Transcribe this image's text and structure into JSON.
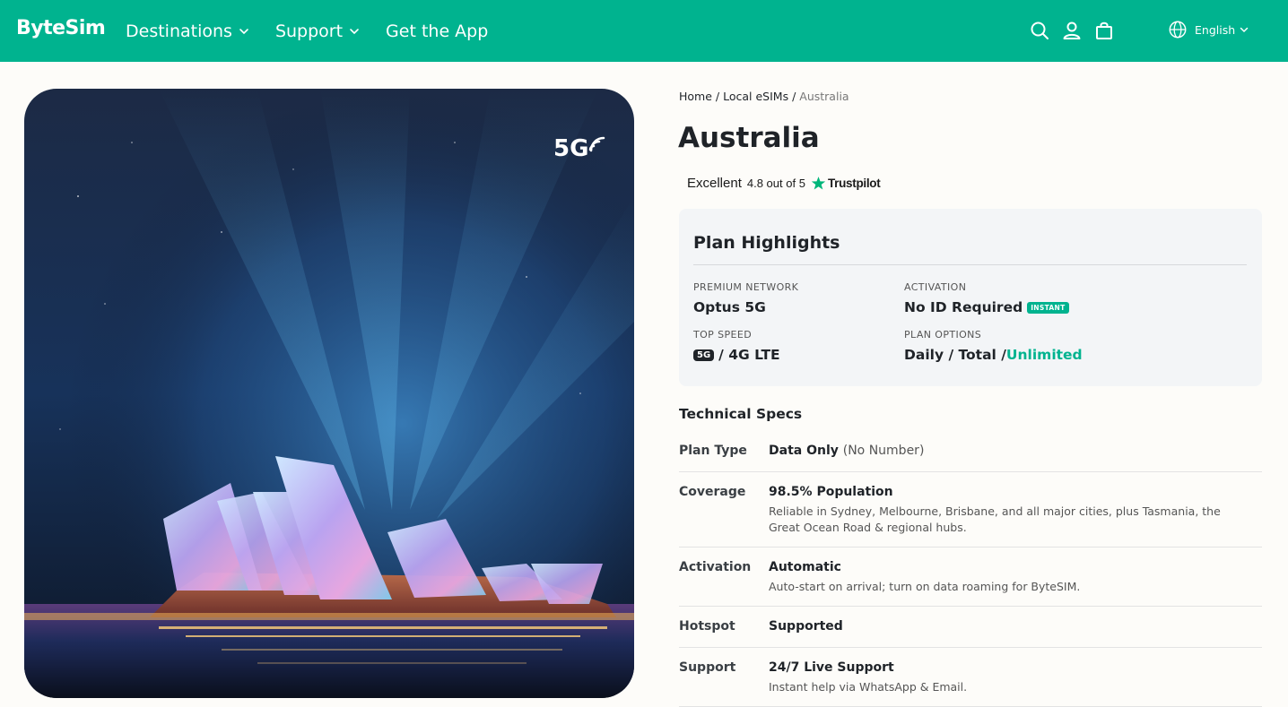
{
  "header": {
    "logo": "ByteSim",
    "nav": [
      {
        "label": "Destinations",
        "has_dropdown": true
      },
      {
        "label": "Support",
        "has_dropdown": true
      },
      {
        "label": "Get the App",
        "has_dropdown": false
      }
    ],
    "icons": [
      "search-icon",
      "user-icon",
      "bag-icon"
    ],
    "language": "English",
    "brand_color": "#00b38f"
  },
  "hero": {
    "badge": "5G"
  },
  "breadcrumb": {
    "home": "Home",
    "sep": "/",
    "section": "Local eSIMs",
    "current": "Australia"
  },
  "page_title": "Australia",
  "rating": {
    "label": "Excellent",
    "score": "4.8 out of 5",
    "provider": "Trustpilot"
  },
  "highlights": {
    "title": "Plan Highlights",
    "network": {
      "label": "PREMIUM NETWORK",
      "value": "Optus 5G"
    },
    "activation": {
      "label": "ACTIVATION",
      "value": "No ID Required",
      "badge": "INSTANT"
    },
    "speed": {
      "label": "TOP SPEED",
      "badge": "5G",
      "value": "/ 4G LTE"
    },
    "options": {
      "label": "PLAN OPTIONS",
      "value": "Daily / Total /",
      "highlight": "Unlimited"
    }
  },
  "specs": {
    "title": "Technical Specs",
    "rows": [
      {
        "key": "Plan Type",
        "value": "Data Only",
        "note": "(No Number)",
        "desc": ""
      },
      {
        "key": "Coverage",
        "value": "98.5% Population",
        "note": "",
        "desc": "Reliable in Sydney, Melbourne, Brisbane, and all major cities, plus Tasmania, the Great Ocean Road & regional hubs."
      },
      {
        "key": "Activation",
        "value": "Automatic",
        "note": "",
        "desc": "Auto-start on arrival; turn on data roaming for ByteSIM."
      },
      {
        "key": "Hotspot",
        "value": "Supported",
        "note": "",
        "desc": ""
      },
      {
        "key": "Support",
        "value": "24/7 Live Support",
        "note": "",
        "desc": "Instant help via WhatsApp & Email."
      }
    ]
  }
}
